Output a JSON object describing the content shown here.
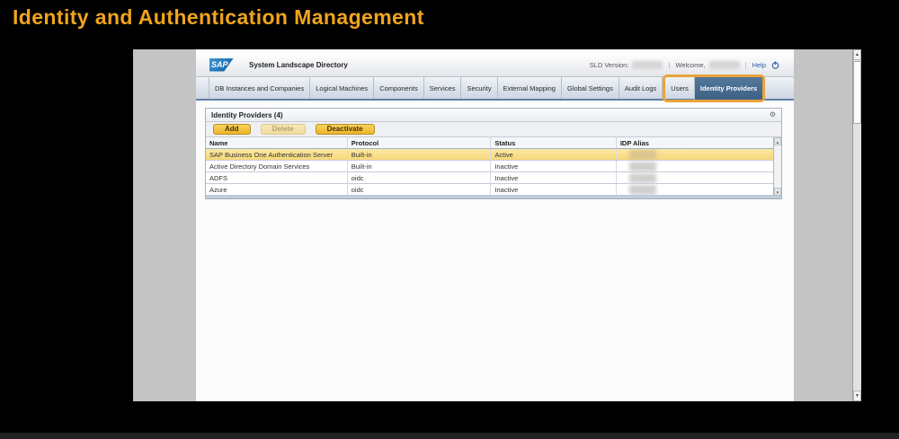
{
  "slide": {
    "title": "Identity and Authentication Management"
  },
  "masthead": {
    "logo": "SAP",
    "app_title": "System Landscape Directory",
    "sld_version_label": "SLD Version:",
    "welcome_label": "Welcome,",
    "separator": "|",
    "help_label": "Help"
  },
  "tabs": [
    {
      "label": "DB Instances and Companies",
      "selected": false
    },
    {
      "label": "Logical Machines",
      "selected": false
    },
    {
      "label": "Components",
      "selected": false
    },
    {
      "label": "Services",
      "selected": false
    },
    {
      "label": "Security",
      "selected": false
    },
    {
      "label": "External Mapping",
      "selected": false
    },
    {
      "label": "Global Settings",
      "selected": false
    },
    {
      "label": "Audit Logs",
      "selected": false
    },
    {
      "label": "Users",
      "selected": false
    },
    {
      "label": "Identity Providers",
      "selected": true
    }
  ],
  "panel": {
    "title": "Identity Providers (4)",
    "buttons": [
      {
        "label": "Add",
        "enabled": true
      },
      {
        "label": "Delete",
        "enabled": false
      },
      {
        "label": "Deactivate",
        "enabled": true
      }
    ],
    "table": {
      "columns": [
        "Name",
        "Protocol",
        "Status",
        "IDP Alias"
      ],
      "rows": [
        {
          "name": "SAP Business One Authentication Server",
          "protocol": "Built-in",
          "status": "Active",
          "idp_alias_redacted": true,
          "selected": true
        },
        {
          "name": "Active Directory Domain Services",
          "protocol": "Built-in",
          "status": "Inactive",
          "idp_alias_redacted": true,
          "selected": false
        },
        {
          "name": "ADFS",
          "protocol": "oidc",
          "status": "Inactive",
          "idp_alias_redacted": true,
          "selected": false
        },
        {
          "name": "Azure",
          "protocol": "oidc",
          "status": "Inactive",
          "idp_alias_redacted": true,
          "selected": false
        }
      ]
    }
  },
  "icons": {
    "settings": "⚙",
    "scroll_up": "▲",
    "scroll_down": "▼"
  },
  "colors": {
    "slide_title": "#F0A41C",
    "annotation_box": "#E9A43C",
    "selected_tab_bg": "#3D6185",
    "selected_row_bg": "#F7D878",
    "button_gold": "#EDB52B",
    "sap_blue": "#0E5DA3",
    "help_link": "#2A5DB0"
  }
}
